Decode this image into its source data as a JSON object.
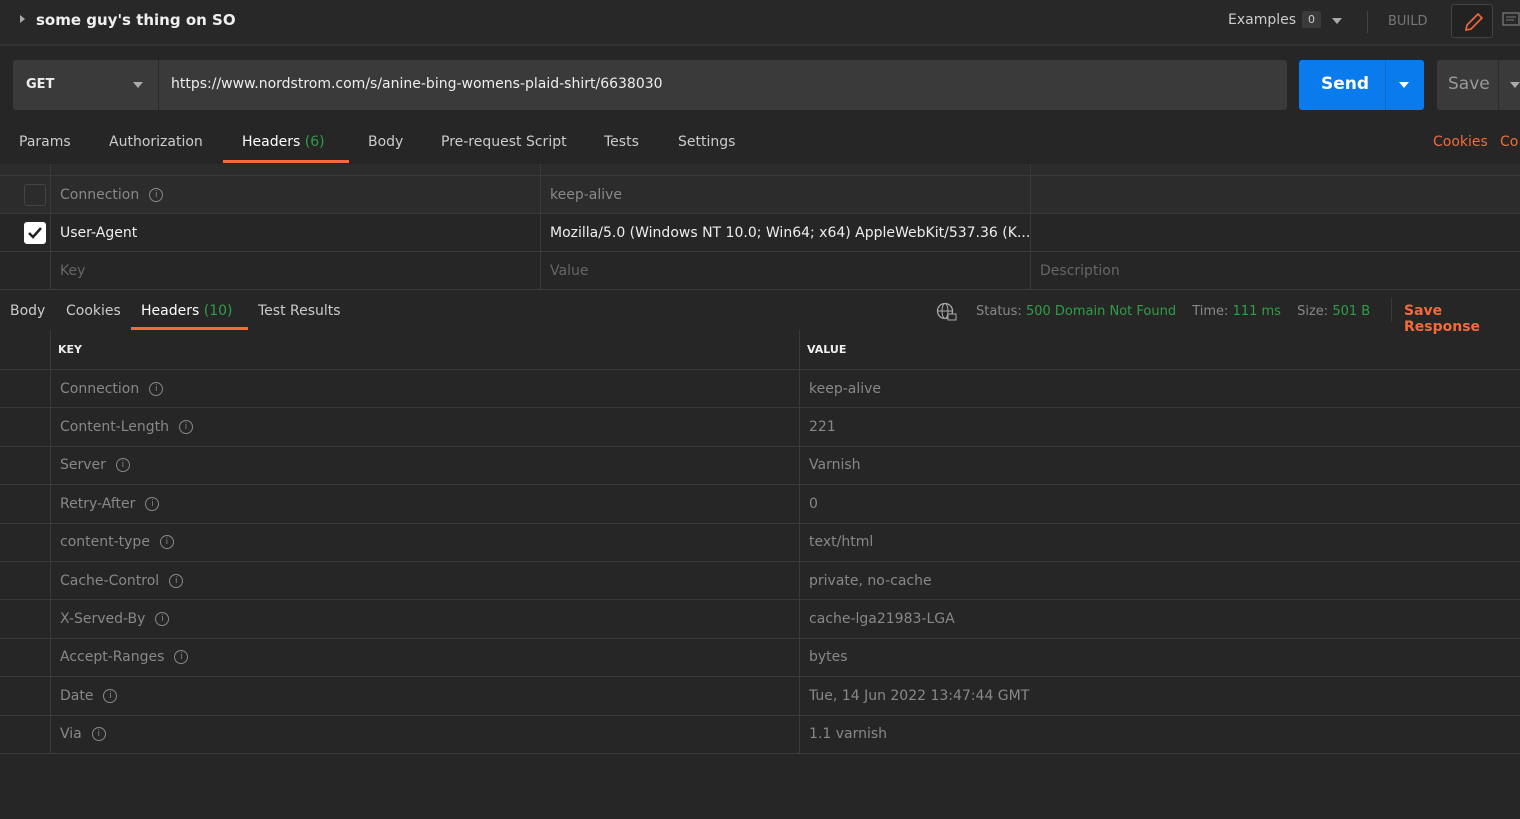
{
  "window": {
    "title": "some guy's thing on SO",
    "examples_label": "Examples",
    "examples_count": "0",
    "build_label": "BUILD"
  },
  "request": {
    "method": "GET",
    "url": "https://www.nordstrom.com/s/anine-bing-womens-plaid-shirt/6638030",
    "send_label": "Send",
    "save_label": "Save"
  },
  "request_tabs": {
    "items": [
      "Params",
      "Authorization",
      "Headers",
      "Body",
      "Pre-request Script",
      "Tests",
      "Settings"
    ],
    "headers_count": "(6)",
    "active": "Headers",
    "cookies_label": "Cookies",
    "code_label": "Co"
  },
  "request_headers": {
    "rows": [
      {
        "enabled": false,
        "key": "Connection",
        "value": "keep-alive",
        "description": ""
      },
      {
        "enabled": true,
        "key": "User-Agent",
        "value": "Mozilla/5.0 (Windows NT 10.0; Win64; x64) AppleWebKit/537.36 (K...",
        "description": ""
      }
    ],
    "placeholders": {
      "key": "Key",
      "value": "Value",
      "description": "Description"
    }
  },
  "response_tabs": {
    "items": [
      "Body",
      "Cookies",
      "Headers",
      "Test Results"
    ],
    "headers_count": "(10)",
    "active": "Headers"
  },
  "response_status": {
    "status_label": "Status:",
    "status": "500 Domain Not Found",
    "time_label": "Time:",
    "time": "111 ms",
    "size_label": "Size:",
    "size": "501 B",
    "save_response": "Save Response"
  },
  "response_headers": {
    "columns": [
      "KEY",
      "VALUE"
    ],
    "rows": [
      {
        "key": "Connection",
        "value": "keep-alive"
      },
      {
        "key": "Content-Length",
        "value": "221"
      },
      {
        "key": "Server",
        "value": "Varnish"
      },
      {
        "key": "Retry-After",
        "value": "0"
      },
      {
        "key": "content-type",
        "value": "text/html"
      },
      {
        "key": "Cache-Control",
        "value": "private, no-cache"
      },
      {
        "key": "X-Served-By",
        "value": "cache-lga21983-LGA"
      },
      {
        "key": "Accept-Ranges",
        "value": "bytes"
      },
      {
        "key": "Date",
        "value": "Tue, 14 Jun 2022 13:47:44 GMT"
      },
      {
        "key": "Via",
        "value": "1.1 varnish"
      }
    ]
  },
  "colors": {
    "accent": "#f26b3a",
    "send": "#097bed",
    "success": "#2e9e48"
  }
}
